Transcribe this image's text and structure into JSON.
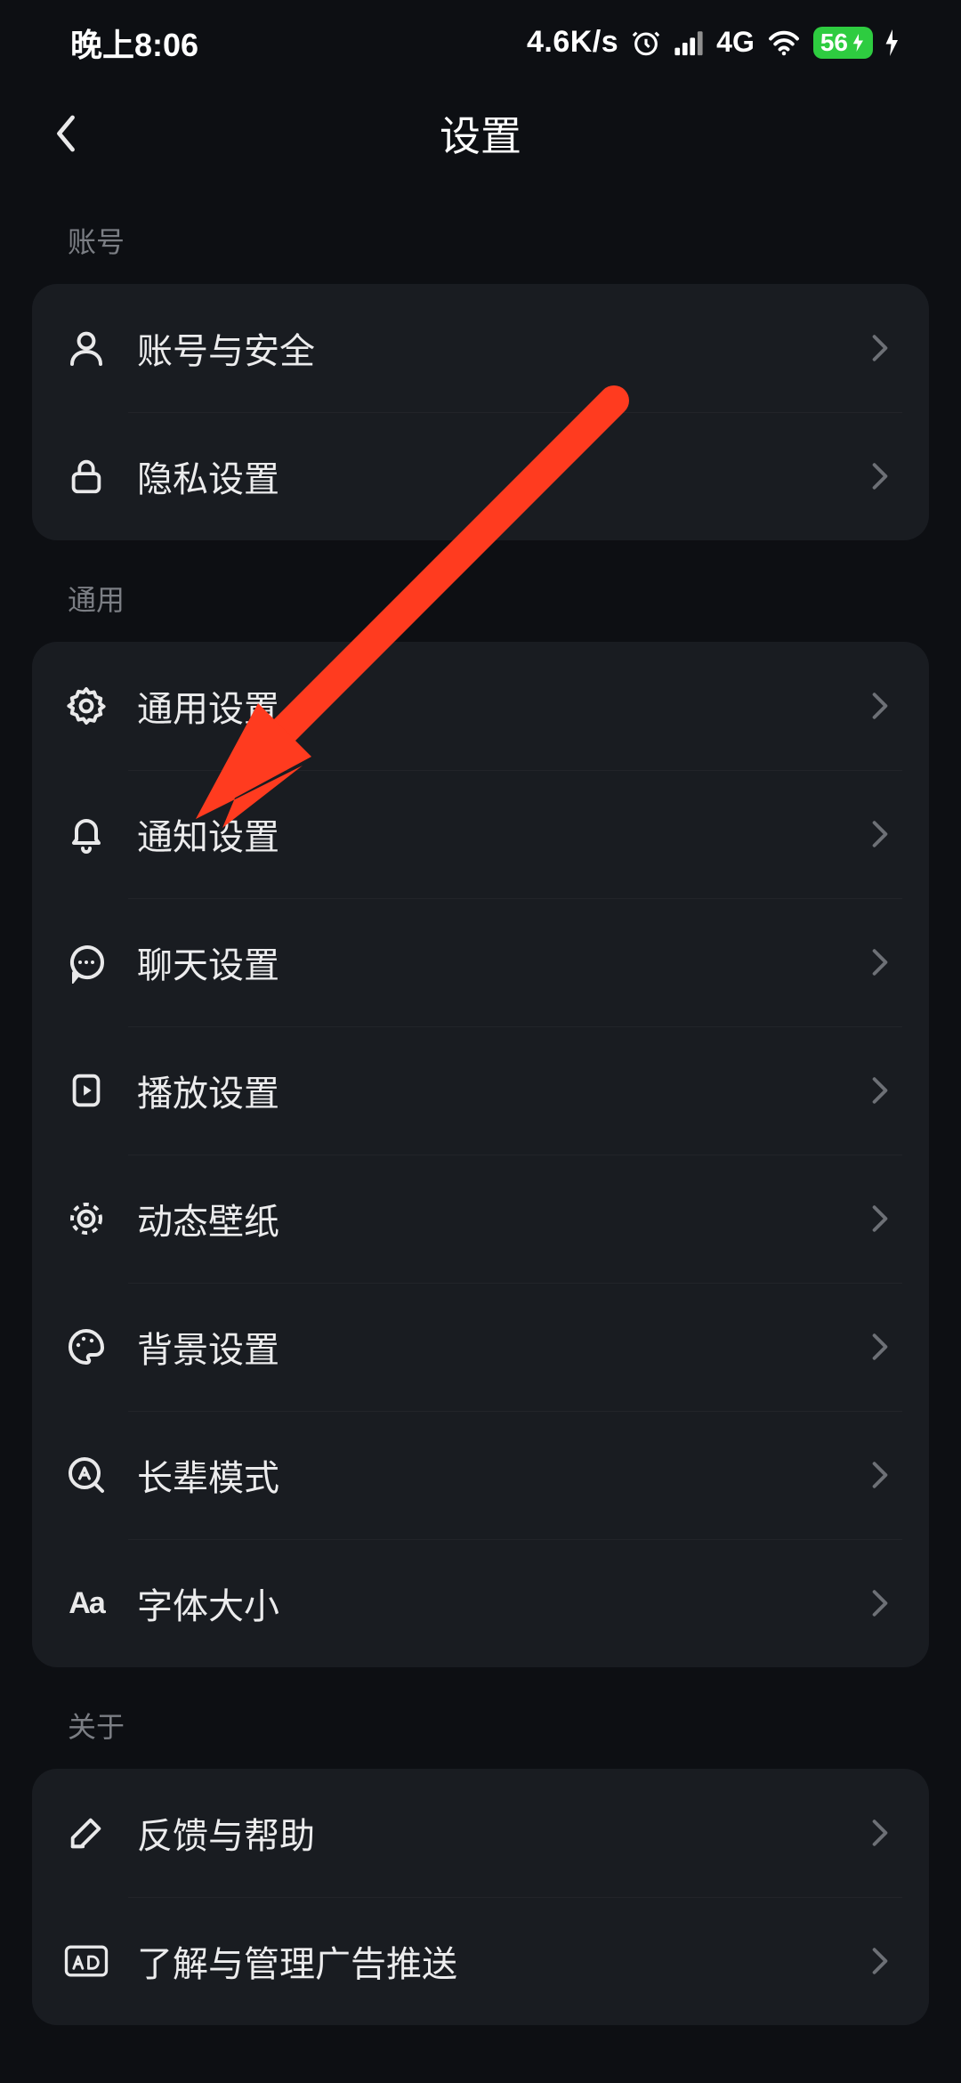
{
  "status": {
    "time": "晚上8:06",
    "speed": "4.6K/s",
    "network": "4G",
    "battery_text": "56"
  },
  "header": {
    "title": "设置"
  },
  "sections": [
    {
      "title": "账号",
      "items": [
        {
          "id": "account-security",
          "label": "账号与安全",
          "icon": "user-icon"
        },
        {
          "id": "privacy",
          "label": "隐私设置",
          "icon": "lock-icon"
        }
      ]
    },
    {
      "title": "通用",
      "items": [
        {
          "id": "general",
          "label": "通用设置",
          "icon": "gear-icon"
        },
        {
          "id": "notifications",
          "label": "通知设置",
          "icon": "bell-icon"
        },
        {
          "id": "chat",
          "label": "聊天设置",
          "icon": "chat-icon"
        },
        {
          "id": "playback",
          "label": "播放设置",
          "icon": "play-icon"
        },
        {
          "id": "live-wallpaper",
          "label": "动态壁纸",
          "icon": "target-icon"
        },
        {
          "id": "background",
          "label": "背景设置",
          "icon": "palette-icon"
        },
        {
          "id": "elder-mode",
          "label": "长辈模式",
          "icon": "magnify-a-icon"
        },
        {
          "id": "font-size",
          "label": "字体大小",
          "icon": "font-aa-icon"
        }
      ]
    },
    {
      "title": "关于",
      "items": [
        {
          "id": "feedback",
          "label": "反馈与帮助",
          "icon": "pencil-icon"
        },
        {
          "id": "ad-management",
          "label": "了解与管理广告推送",
          "icon": "ad-icon"
        }
      ]
    }
  ]
}
